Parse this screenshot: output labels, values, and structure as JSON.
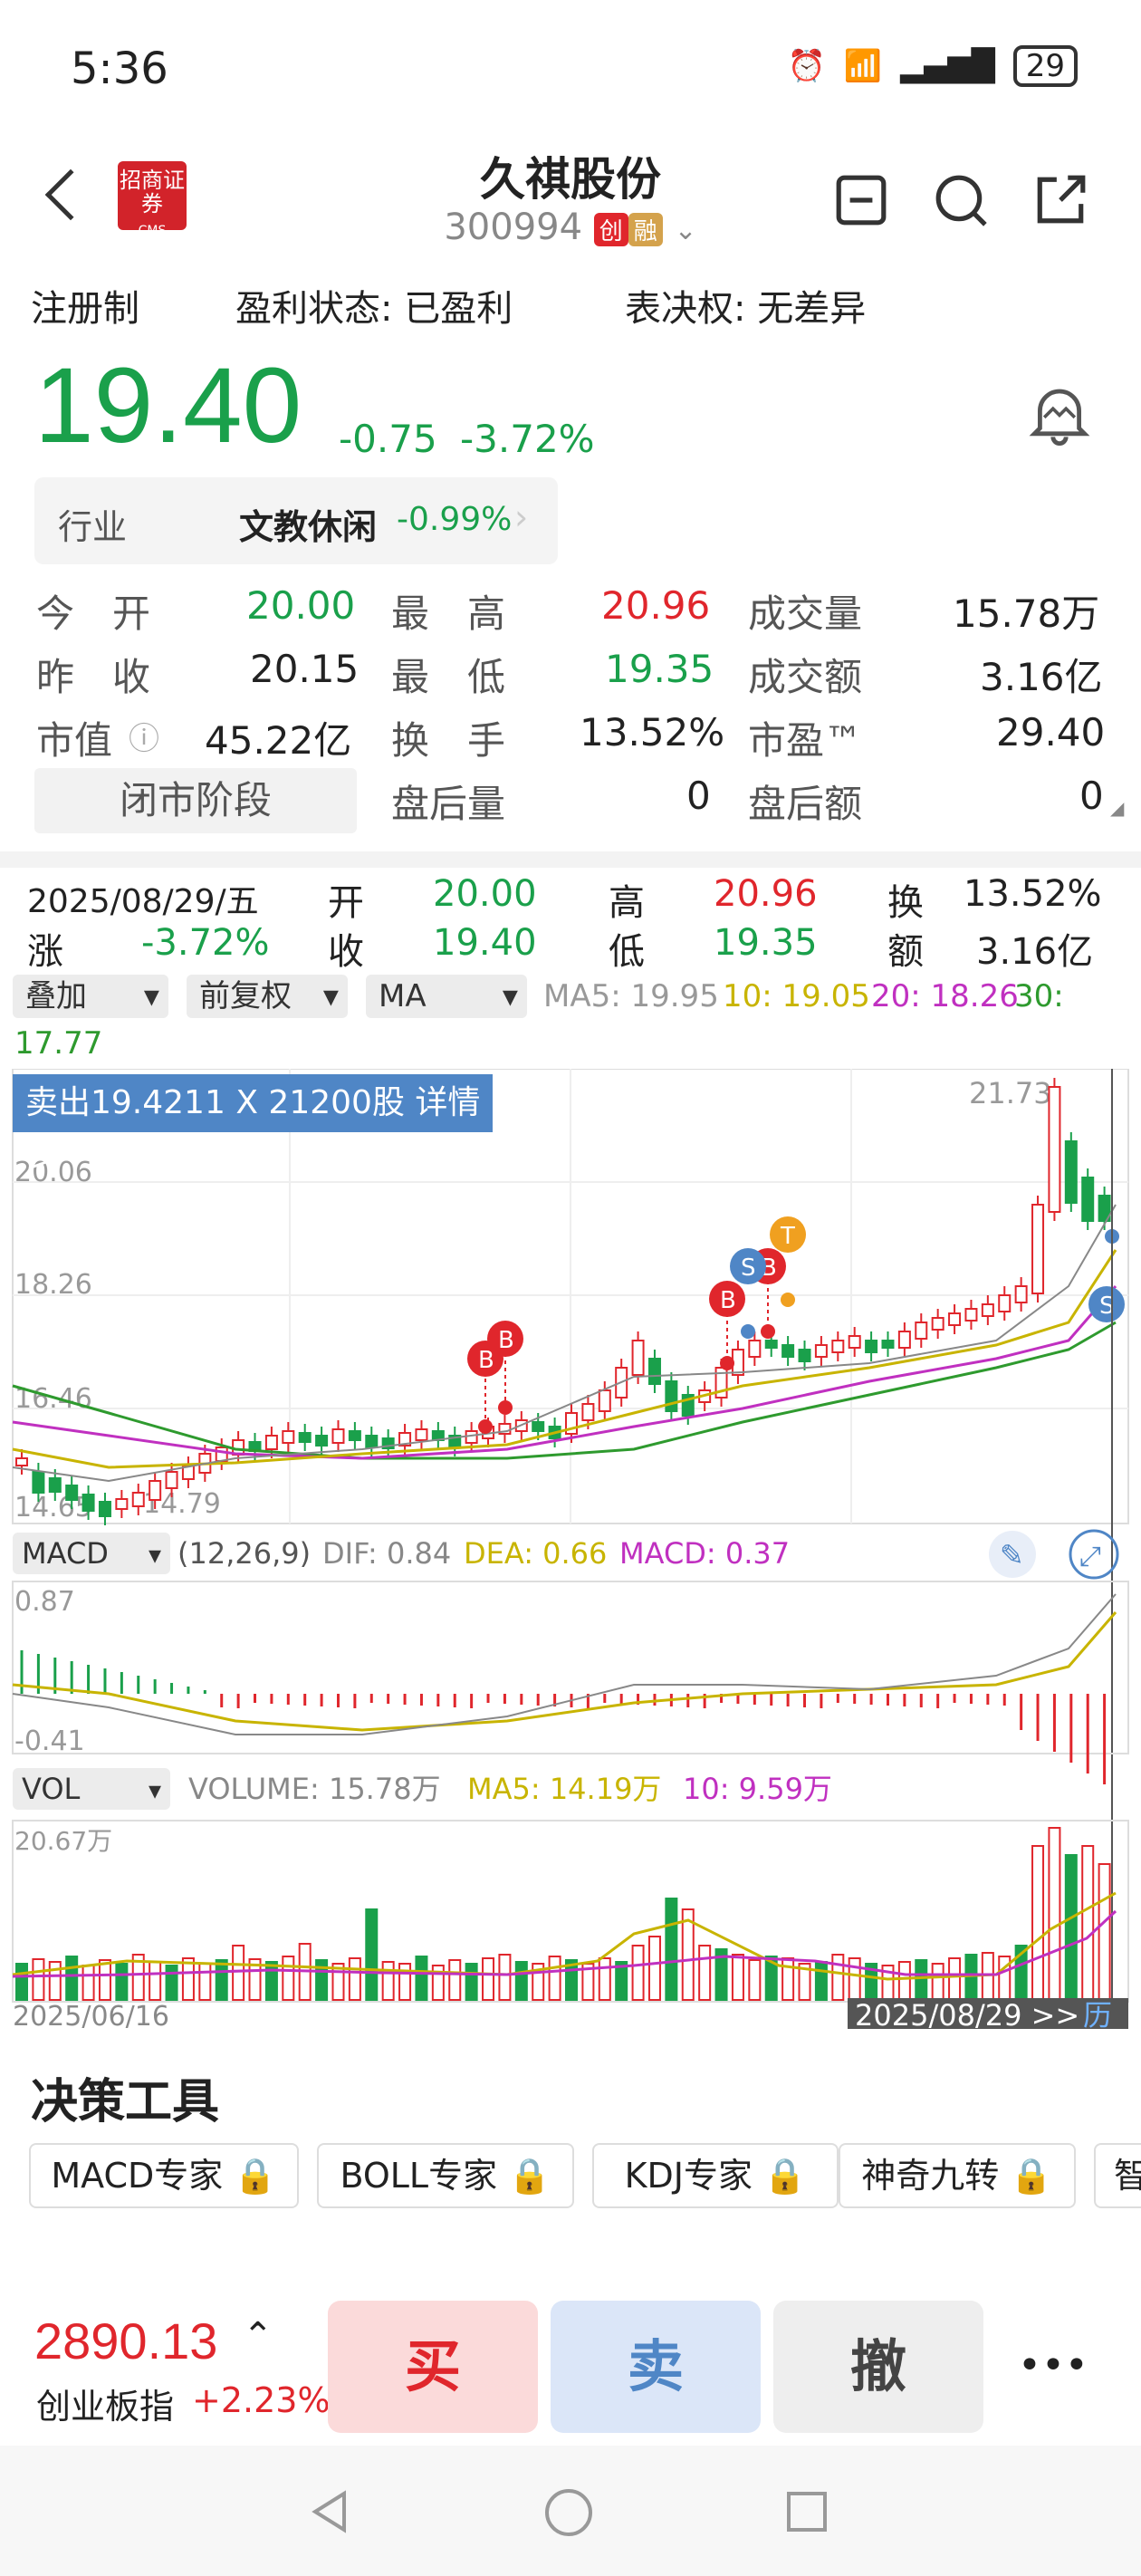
{
  "status_bar": {
    "time": "5:36",
    "signal_label": "6",
    "battery": "29"
  },
  "header": {
    "broker_logo_text": "招商证券",
    "broker_logo_sub": "CMS",
    "stock_name": "久祺股份",
    "stock_code": "300994",
    "tag_chuang": "创",
    "tag_rong": "融"
  },
  "tags_row": {
    "registration": "注册制",
    "profit_status": "盈利状态: 已盈利",
    "voting_rights": "表决权: 无差异"
  },
  "price": {
    "last": "19.40",
    "change": "-0.75",
    "change_pct": "-3.72%"
  },
  "industry": {
    "label": "行业",
    "name": "文教休闲",
    "change_pct": "-0.99%"
  },
  "quote": {
    "open_label": "今　开",
    "open": "20.00",
    "high_label": "最　高",
    "high": "20.96",
    "volume_label": "成交量",
    "volume": "15.78万",
    "prev_close_label": "昨　收",
    "prev_close": "20.15",
    "low_label": "最　低",
    "low": "19.35",
    "amount_label": "成交额",
    "amount": "3.16亿",
    "mktcap_label": "市值",
    "mktcap": "45.22亿",
    "turnover_label": "换　手",
    "turnover": "13.52%",
    "pe_label": "市盈™",
    "pe": "29.40",
    "phase": "闭市阶段",
    "after_vol_label": "盘后量",
    "after_vol": "0",
    "after_amt_label": "盘后额",
    "after_amt": "0"
  },
  "day_summary": {
    "date": "2025/08/29/五",
    "chg_label": "涨",
    "chg": "-3.72%",
    "open_label": "开",
    "open": "20.00",
    "close_label": "收",
    "close": "19.40",
    "high_label": "高",
    "high": "20.96",
    "low_label": "低",
    "low": "19.35",
    "turn_label": "换",
    "turn": "13.52%",
    "amt_label": "额",
    "amt": "3.16亿"
  },
  "indicator_toolbar": {
    "overlay": "叠加",
    "adjust": "前复权",
    "ma": "MA",
    "ma5": "MA5: 19.95",
    "ma10": "10: 19.05",
    "ma20": "20: 18.26",
    "ma30": "30:",
    "ma30_val": "17.77"
  },
  "trade_banner": "卖出19.4211 X 21200股 详情>",
  "kline_labels": {
    "max": "21.73",
    "y1": "20.06",
    "y2": "18.26",
    "y3": "16.46",
    "y4": "14.65",
    "min": "14.79"
  },
  "macd_bar": {
    "name": "MACD",
    "params": "(12,26,9)",
    "dif": "DIF: 0.84",
    "dea": "DEA: 0.66",
    "macd": "MACD: 0.37",
    "top": "0.87",
    "bottom": "-0.41"
  },
  "vol_bar": {
    "name": "VOL",
    "volume": "VOLUME: 15.78万",
    "ma5": "MA5: 14.19万",
    "ma10": "10: 9.59万",
    "top": "20.67万",
    "start_date": "2025/06/16",
    "end_date": "2025/08/29 >>",
    "end_tag": "历"
  },
  "colors": {
    "up": "#e0262c",
    "down": "#1aa04b",
    "ma5": "#888888",
    "ma10": "#c8b400",
    "ma20": "#c030c0",
    "ma30": "#2e9a2e"
  },
  "decision": {
    "title": "决策工具",
    "tools": [
      "MACD专家",
      "BOLL专家",
      "KDJ专家",
      "神奇九转",
      "智"
    ]
  },
  "bottom": {
    "index_value": "2890.13",
    "index_name": "创业板指",
    "index_chg": "+2.23%",
    "buy": "买",
    "sell": "卖",
    "cancel": "撤",
    "more": "•••"
  }
}
